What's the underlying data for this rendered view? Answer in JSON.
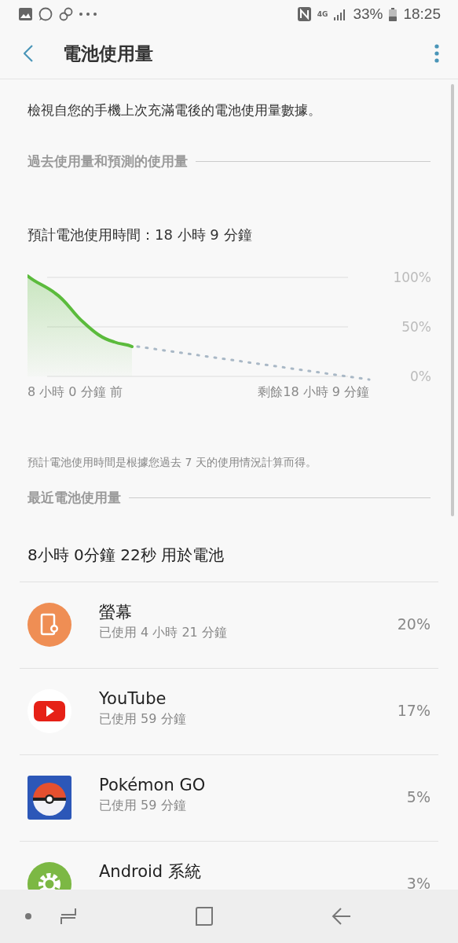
{
  "status_bar": {
    "network": "4G",
    "battery": "33%",
    "time": "18:25"
  },
  "app_bar": {
    "title": "電池使用量"
  },
  "description": "檢視自您的手機上次充滿電後的電池使用量數據。",
  "history_section": {
    "title": "過去使用量和預測的使用量",
    "estimate": "預計電池使用時間：18 小時 9 分鐘",
    "chart_labels": [
      "100%",
      "50%",
      "0%"
    ],
    "start_label": "8 小時 0 分鐘 前",
    "end_label": "剩餘18 小時 9 分鐘",
    "note": "預計電池使用時間是根據您過去 7 天的使用情況計算而得。"
  },
  "recent_section": {
    "title": "最近電池使用量",
    "total": "8小時 0分鐘 22秒 用於電池"
  },
  "apps": [
    {
      "kind": "screen",
      "name": "螢幕",
      "usage": "已使用 4 小時 21 分鐘",
      "percent": "20%"
    },
    {
      "kind": "youtube",
      "name": "YouTube",
      "usage": "已使用 59 分鐘",
      "percent": "17%"
    },
    {
      "kind": "pokemon",
      "name": "Pokémon GO",
      "usage": "已使用 59 分鐘",
      "percent": "5%"
    },
    {
      "kind": "system",
      "name": "Android 系統",
      "percent": "3%"
    }
  ]
}
